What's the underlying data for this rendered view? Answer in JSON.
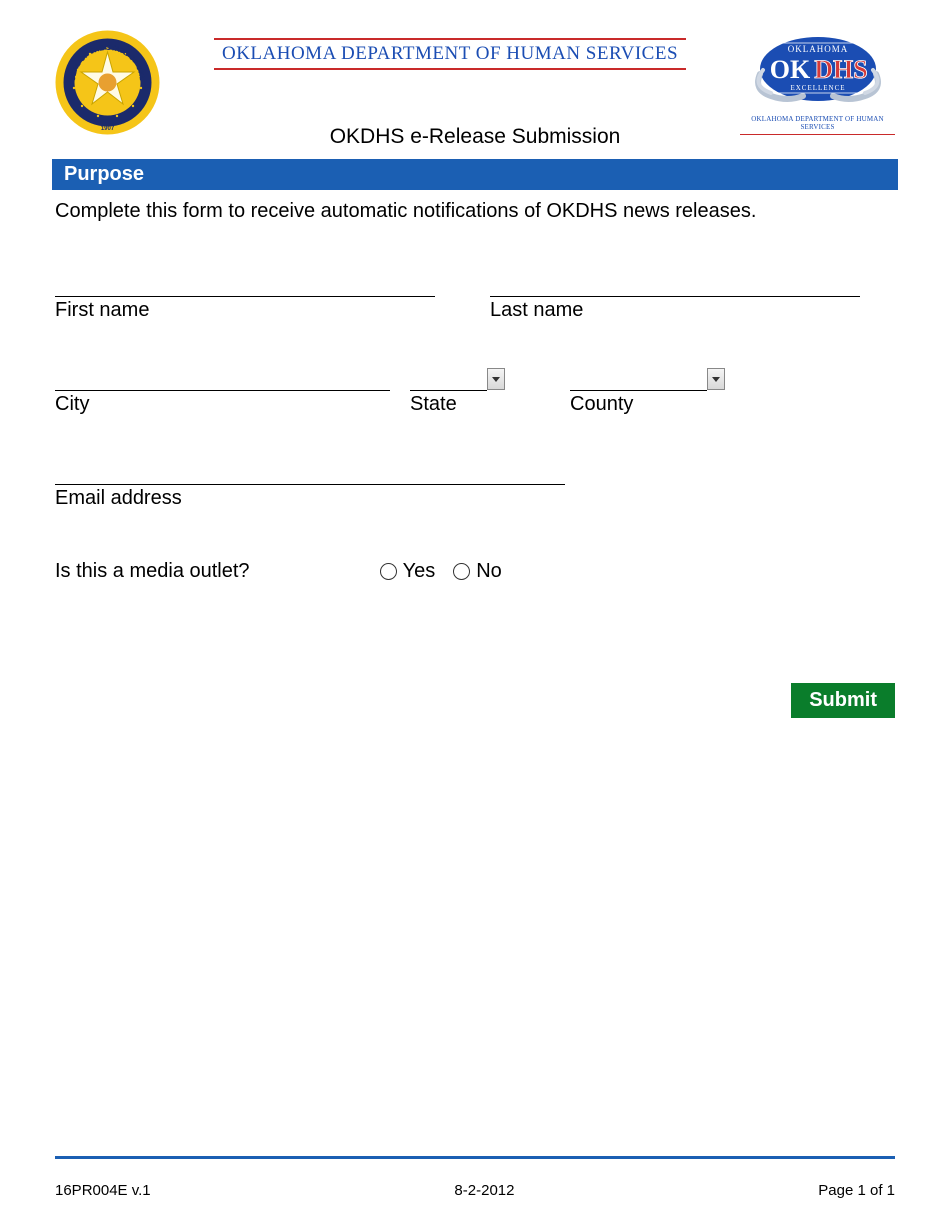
{
  "header": {
    "department_name": "OKLAHOMA DEPARTMENT OF HUMAN SERVICES",
    "logo_badge_top": "OKLAHOMA",
    "logo_badge_main_ok": "OK",
    "logo_badge_main_dhs": "DHS",
    "logo_badge_bottom": "EXCELLENCE",
    "logo_subline": "OKLAHOMA DEPARTMENT OF HUMAN SERVICES",
    "seal_top": "THE STATE",
    "seal_left": "GREAT SEAL OF",
    "seal_right": "OF OKLAHOMA",
    "seal_year": "1907"
  },
  "page_title": "OKDHS e-Release Submission",
  "section": {
    "purpose_heading": "Purpose",
    "purpose_text": "Complete this form to receive automatic notifications of OKDHS news releases."
  },
  "form": {
    "first_name_label": "First name",
    "first_name_value": "",
    "last_name_label": "Last name",
    "last_name_value": "",
    "city_label": "City",
    "city_value": "",
    "state_label": "State",
    "state_value": "",
    "county_label": "County",
    "county_value": "",
    "email_label": "Email address",
    "email_value": "",
    "media_question": "Is this a media outlet?",
    "yes_label": "Yes",
    "no_label": "No",
    "submit_label": "Submit"
  },
  "footer": {
    "form_number": "16PR004E v.1",
    "date": "8-2-2012",
    "page": "Page 1 of 1"
  }
}
